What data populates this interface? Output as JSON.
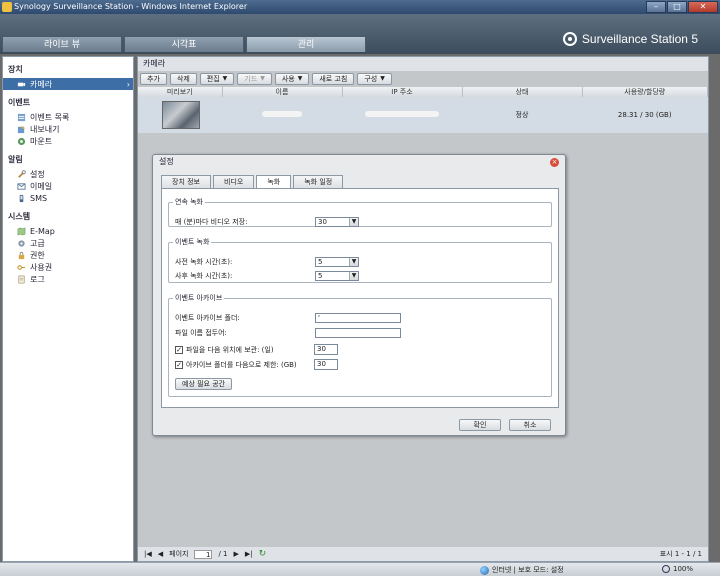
{
  "window": {
    "title": "Synology Surveillance Station - Windows Internet Explorer",
    "min": "–",
    "max": "□",
    "close": "✕"
  },
  "header": {
    "tabs": [
      "라이브 뷰",
      "시각표",
      "관리"
    ],
    "active_tab": 2,
    "brand": "Surveillance Station 5"
  },
  "sidebar": {
    "groups": [
      {
        "label": "장치",
        "items": [
          {
            "label": "카메라",
            "icon": "camera-icon",
            "active": true
          }
        ]
      },
      {
        "label": "이벤트",
        "items": [
          {
            "label": "이벤트 목록",
            "icon": "list-icon"
          },
          {
            "label": "내보내기",
            "icon": "export-icon"
          },
          {
            "label": "마운트",
            "icon": "mount-icon"
          }
        ]
      },
      {
        "label": "알림",
        "items": [
          {
            "label": "설정",
            "icon": "wrench-icon"
          },
          {
            "label": "이메일",
            "icon": "mail-icon"
          },
          {
            "label": "SMS",
            "icon": "phone-icon"
          }
        ]
      },
      {
        "label": "시스템",
        "items": [
          {
            "label": "E-Map",
            "icon": "map-icon"
          },
          {
            "label": "고급",
            "icon": "gear-icon"
          },
          {
            "label": "권한",
            "icon": "lock-icon"
          },
          {
            "label": "사용권",
            "icon": "key-icon"
          },
          {
            "label": "로그",
            "icon": "log-icon"
          }
        ]
      }
    ]
  },
  "main": {
    "title": "카메라",
    "toolbar": [
      {
        "label": "추가"
      },
      {
        "label": "삭제"
      },
      {
        "label": "편집",
        "dropdown": true
      },
      {
        "label": "기드",
        "dropdown": true,
        "disabled": true
      },
      {
        "label": "사용",
        "dropdown": true
      },
      {
        "label": "새로 고침"
      },
      {
        "label": "구성",
        "dropdown": true
      }
    ],
    "columns": [
      "미리보기",
      "이름",
      "IP 주소",
      "상태",
      "사용량/할당량"
    ],
    "rows": [
      {
        "status": "정상",
        "usage": "28.31 / 30 (GB)"
      }
    ],
    "footer": {
      "page_label": "페이지",
      "page": "1",
      "of": "/ 1",
      "display": "표시 1 - 1 / 1"
    }
  },
  "dialog": {
    "title": "설정",
    "tabs": [
      "장치 정보",
      "비디오",
      "녹화",
      "녹화 일정"
    ],
    "active_tab": 2,
    "continuous": {
      "legend": "연속 녹화",
      "label": "매 (분)마다 비디오 저장:",
      "value": "30"
    },
    "event": {
      "legend": "이벤트 녹화",
      "pre_label": "사전 녹화 시간(초):",
      "pre_value": "5",
      "post_label": "사후 녹화 시간(초):",
      "post_value": "5"
    },
    "archive": {
      "legend": "이벤트 아카이브",
      "folder_label": "이벤트 아카이브 폴더:",
      "folder_value": "'",
      "prefix_label": "파일 이름 접두어:",
      "prefix_value": "",
      "keep_label": "파일을 다음 위치에 보관: (일)",
      "keep_value": "30",
      "limit_label": "아카이브 폴더를 다음으로 제한: (GB)",
      "limit_value": "30",
      "estimate_btn": "예상 필요 공간"
    },
    "ok": "확인",
    "cancel": "취소"
  },
  "statusbar": {
    "zone": "인터넷 | 보호 모드: 설정",
    "zoom": "100%"
  }
}
